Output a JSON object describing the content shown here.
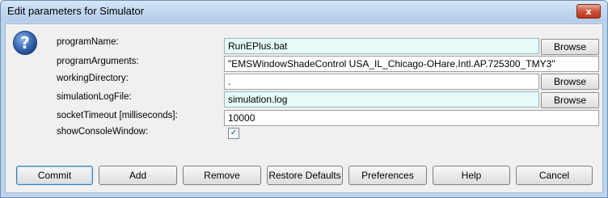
{
  "window": {
    "title": "Edit parameters for Simulator",
    "close_glyph": "x"
  },
  "icons": {
    "help": "question-mark-icon",
    "close": "close-icon"
  },
  "fields": {
    "programName": {
      "label": "programName:",
      "value": "RunEPlus.bat"
    },
    "programArguments": {
      "label": "programArguments:",
      "value": "\"EMSWindowShadeControl USA_IL_Chicago-OHare.Intl.AP.725300_TMY3\""
    },
    "workingDirectory": {
      "label": "workingDirectory:",
      "value": "."
    },
    "simulationLogFile": {
      "label": "simulationLogFile:",
      "value": "simulation.log"
    },
    "socketTimeout": {
      "label": "socketTimeout [milliseconds]:",
      "value": "10000"
    },
    "showConsoleWindow": {
      "label": "showConsoleWindow:",
      "checked": true,
      "check_glyph": "✓"
    }
  },
  "browse_label": "Browse",
  "buttons": {
    "commit": "Commit",
    "add": "Add",
    "remove": "Remove",
    "restore_defaults": "Restore Defaults",
    "preferences": "Preferences",
    "help": "Help",
    "cancel": "Cancel"
  },
  "colors": {
    "titlebar": "#c3d8f0",
    "highlight_field": "#e6fafa",
    "help_icon": "#3b6cb5",
    "close_button": "#d0533c"
  }
}
